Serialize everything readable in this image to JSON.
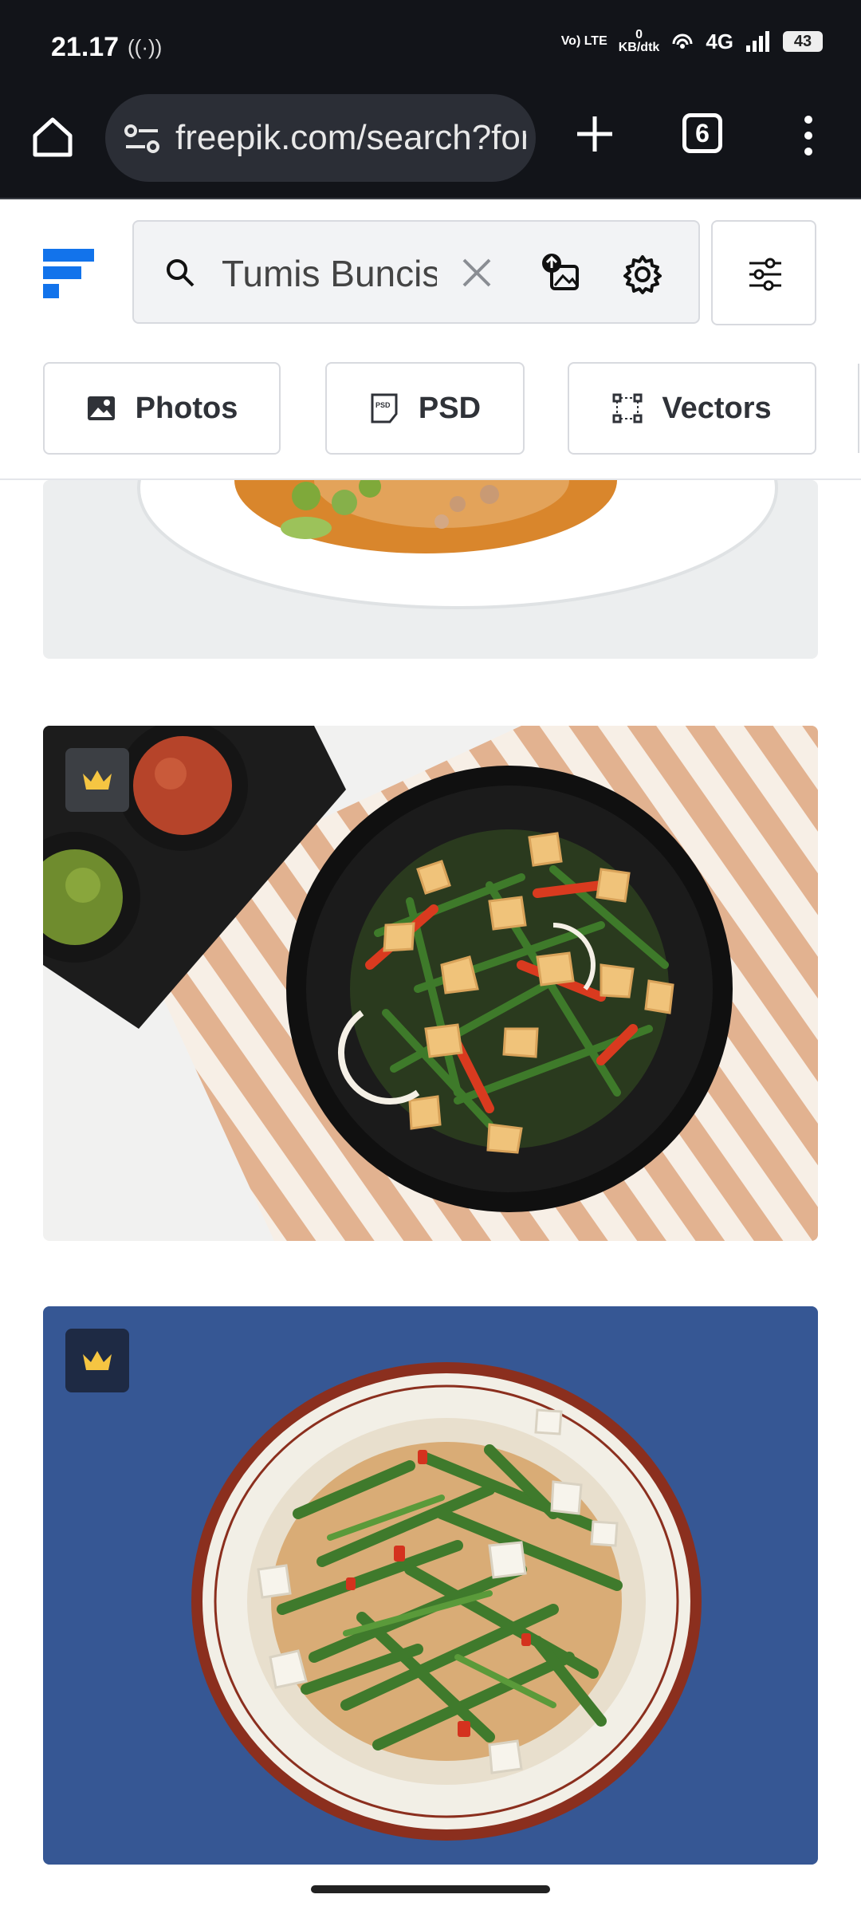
{
  "status_bar": {
    "time": "21.17",
    "network_volte": "Vo) LTE",
    "data_rate_value": "0",
    "data_rate_unit": "KB/dtk",
    "network_type": "4G",
    "battery": "43"
  },
  "browser": {
    "url": "freepik.com/search?format=search&query=Tumis+Buncis",
    "tab_count": "6"
  },
  "search": {
    "query": "Tumis Buncis"
  },
  "filters": [
    {
      "label": "Photos",
      "icon": "image-icon"
    },
    {
      "label": "PSD",
      "icon": "psd-file-icon"
    },
    {
      "label": "Vectors",
      "icon": "vector-icon"
    }
  ],
  "results": [
    {
      "subject": "partial dish with curry sauce",
      "premium": false
    },
    {
      "subject": "stir-fried green beans with tofu and chili on black plate",
      "premium": true
    },
    {
      "subject": "sauteed green beans with tofu on white plate with blue background",
      "premium": true
    }
  ],
  "colors": {
    "brand": "#1273eb",
    "premium_crown": "#f5c542",
    "browser_chrome": "#121419"
  }
}
